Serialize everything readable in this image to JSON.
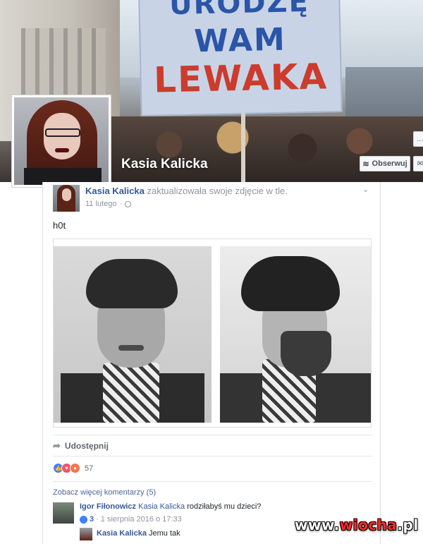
{
  "cover": {
    "sign_lines": [
      "URODZĘ",
      "WAM",
      "LEWAKA"
    ],
    "name": "Kasia Kalicka",
    "follow_button": "Obserwuj"
  },
  "post": {
    "author": "Kasia Kalicka",
    "action_text": "zaktualizowała swoje zdjęcie w tle.",
    "date": "11 lutego",
    "body_text": "h0t",
    "share_label": "Udostępnij",
    "reaction_count": "57",
    "more_comments": "Zobacz więcej komentarzy (5)"
  },
  "comments": [
    {
      "author": "Igor Fiłonowicz",
      "mention": "Kasia Kalicka",
      "text": "rodziłabyś mu dzieci?",
      "likes": "3",
      "timestamp": "1 sierpnia 2016 o 17:33"
    },
    {
      "author": "Kasia Kalicka",
      "text": "Jemu tak"
    }
  ],
  "watermark": {
    "prefix": "www.",
    "brand": "wiocha",
    "suffix": ".pl"
  }
}
